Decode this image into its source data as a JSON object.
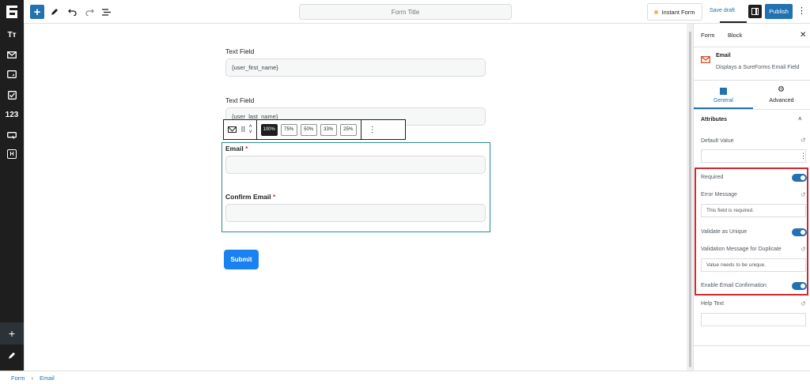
{
  "header": {
    "form_title_placeholder": "Form Title",
    "instant_form_label": "Instant Form",
    "save_draft_label": "Save draft",
    "publish_label": "Publish"
  },
  "sidebar": {
    "items": [
      {
        "icon": "text-type-icon",
        "label": "Tт"
      },
      {
        "icon": "mail-icon"
      },
      {
        "icon": "textarea-icon"
      },
      {
        "icon": "checkbox-icon"
      },
      {
        "icon": "number-icon",
        "label": "123"
      },
      {
        "icon": "button-icon"
      },
      {
        "icon": "hidden-field-icon",
        "label": "H"
      }
    ]
  },
  "canvas": {
    "fields": [
      {
        "label": "Text Field",
        "value": "{user_first_name}"
      },
      {
        "label": "Text Field",
        "value": "{user_last_name}"
      }
    ],
    "email_label": "Email",
    "confirm_email_label": "Confirm Email",
    "required_marker": "*",
    "submit_label": "Submit",
    "toolbar": {
      "widths": [
        "100%",
        "75%",
        "50%",
        "33%",
        "25%"
      ],
      "active_width": "100%"
    }
  },
  "panel": {
    "tabs": [
      "Form",
      "Block"
    ],
    "active_tab": "Block",
    "block_name": "Email",
    "block_desc": "Displays a SureForms Email Field",
    "subtabs": [
      "General",
      "Advanced"
    ],
    "active_subtab": "General",
    "section_title": "Attributes",
    "default_value_label": "Default Value",
    "default_value": "",
    "required_label": "Required",
    "required_on": true,
    "error_message_label": "Error Message",
    "error_message_value": "This field is required.",
    "validate_unique_label": "Validate as Unique",
    "validate_unique_on": true,
    "validation_duplicate_label": "Validation Message for Duplicate",
    "validation_duplicate_value": "Value needs to be unique.",
    "email_confirmation_label": "Enable Email Confirmation",
    "email_confirmation_on": true,
    "help_text_label": "Help Text",
    "help_text_value": ""
  },
  "footer": {
    "breadcrumb": [
      "Form",
      "Email"
    ],
    "separator": "›"
  }
}
